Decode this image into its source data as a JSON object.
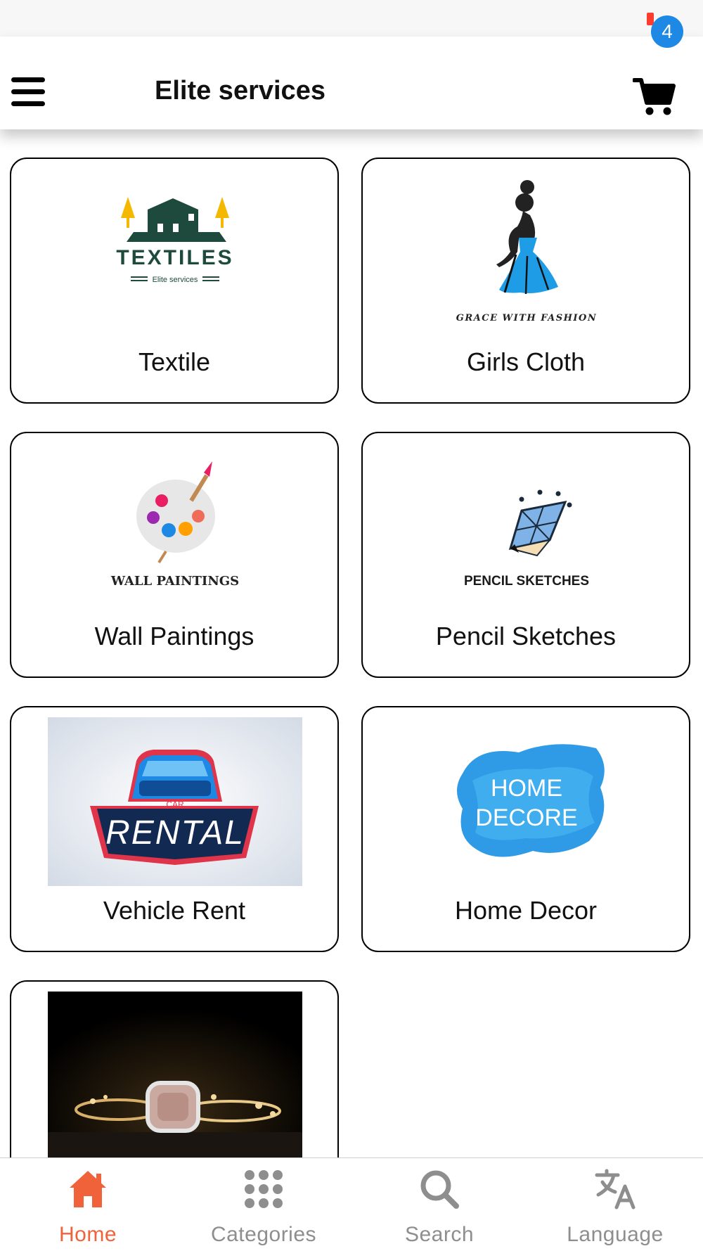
{
  "header": {
    "title": "Elite services",
    "cart_count": "4"
  },
  "categories": [
    {
      "label": "Textile",
      "logo_title": "TEXTILES",
      "logo_subtitle": "Elite services"
    },
    {
      "label": "Girls Cloth",
      "logo_caption": "GRACE WITH FASHION"
    },
    {
      "label": "Wall Paintings",
      "logo_caption": "WALL PAINTINGS"
    },
    {
      "label": "Pencil Sketches",
      "logo_caption": "PENCIL SKETCHES"
    },
    {
      "label": "Vehicle Rent",
      "logo_small": "CAR",
      "logo_title": "RENTAL"
    },
    {
      "label": "Home Decor",
      "logo_line1": "HOME",
      "logo_line2": "DECORE"
    },
    {
      "label": ""
    }
  ],
  "bottom_nav": {
    "items": [
      {
        "label": "Home",
        "icon": "home-icon",
        "active": true
      },
      {
        "label": "Categories",
        "icon": "grid-dots-icon",
        "active": false
      },
      {
        "label": "Search",
        "icon": "search-icon",
        "active": false
      },
      {
        "label": "Language",
        "icon": "translate-icon",
        "active": false
      }
    ]
  },
  "colors": {
    "accent": "#f0623a",
    "badge": "#1e88e5",
    "inactive": "#8e8e8e"
  }
}
